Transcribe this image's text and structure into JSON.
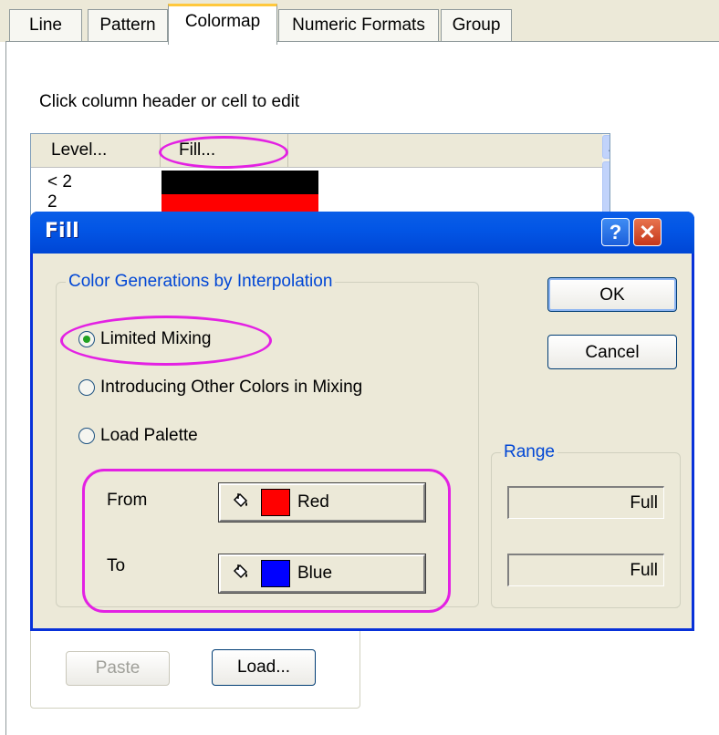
{
  "tabs": [
    {
      "label": "Line",
      "selected": false
    },
    {
      "label": "Pattern",
      "selected": false
    },
    {
      "label": "Colormap",
      "selected": true
    },
    {
      "label": "Numeric Formats",
      "selected": false
    },
    {
      "label": "Group",
      "selected": false
    }
  ],
  "page": {
    "instruction": "Click column header or cell to edit",
    "grid": {
      "columns": [
        "Level...",
        "Fill..."
      ],
      "rows": [
        {
          "level": "< 2",
          "fill_color": "#000000"
        },
        {
          "level": "2",
          "fill_color": "#ff0000"
        }
      ]
    },
    "buttons": {
      "paste": "Paste",
      "load": "Load..."
    }
  },
  "dialog": {
    "title": "Fill",
    "help_glyph": "?",
    "close_glyph": "✕",
    "group_label": "Color Generations by Interpolation",
    "options": [
      {
        "label": "Limited Mixing",
        "checked": true
      },
      {
        "label": "Introducing Other Colors in Mixing",
        "checked": false
      },
      {
        "label": "Load Palette",
        "checked": false
      }
    ],
    "from": {
      "label": "From",
      "color_name": "Red",
      "color": "#ff0000"
    },
    "to": {
      "label": "To",
      "color_name": "Blue",
      "color": "#0000ff"
    },
    "ok": "OK",
    "cancel": "Cancel",
    "range": {
      "label": "Range",
      "values": [
        "Full",
        "Full"
      ]
    }
  },
  "colors": {
    "accent": "#0046d5",
    "highlight": "#e321e3",
    "tab_active": "#ffc83c"
  }
}
